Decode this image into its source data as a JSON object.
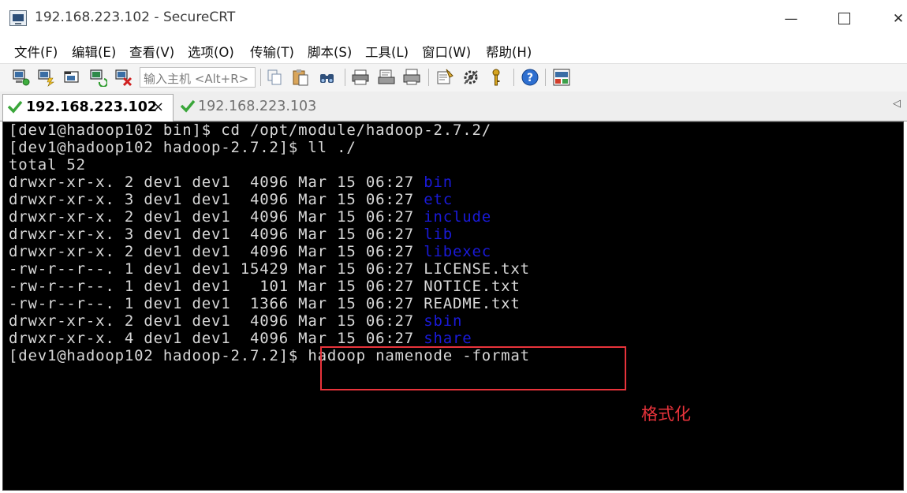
{
  "window": {
    "title": "192.168.223.102 - SecureCRT",
    "minimize_glyph": "—",
    "close_glyph": "✕"
  },
  "menu": [
    "文件(F)",
    "编辑(E)",
    "查看(V)",
    "选项(O)",
    "传输(T)",
    "脚本(S)",
    "工具(L)",
    "窗口(W)",
    "帮助(H)"
  ],
  "toolbar": {
    "host_placeholder": "输入主机 <Alt+R>",
    "icons": [
      "connect-icon",
      "quick-connect-icon",
      "connect-in-tab-icon",
      "reconnect-icon",
      "disconnect-icon",
      "copy-icon",
      "paste-icon",
      "find-icon",
      "print-icon",
      "print-selection-icon",
      "print-screen-icon",
      "session-options-icon",
      "global-options-icon",
      "key-icon",
      "help-icon",
      "sftp-icon"
    ]
  },
  "tabs": [
    {
      "label": "192.168.223.102",
      "active": true,
      "close_glyph": "×"
    },
    {
      "label": "192.168.223.103",
      "active": false
    }
  ],
  "tab_scroll_glyph": "◁",
  "terminal": {
    "lines": [
      {
        "text": "[dev1@hadoop102 bin]$ cd /opt/module/hadoop-2.7.2/",
        "dir": ""
      },
      {
        "text": "[dev1@hadoop102 hadoop-2.7.2]$ ll ./",
        "dir": ""
      },
      {
        "text": "total 52",
        "dir": ""
      },
      {
        "text": "drwxr-xr-x. 2 dev1 dev1  4096 Mar 15 06:27 ",
        "dir": "bin"
      },
      {
        "text": "drwxr-xr-x. 3 dev1 dev1  4096 Mar 15 06:27 ",
        "dir": "etc"
      },
      {
        "text": "drwxr-xr-x. 2 dev1 dev1  4096 Mar 15 06:27 ",
        "dir": "include"
      },
      {
        "text": "drwxr-xr-x. 3 dev1 dev1  4096 Mar 15 06:27 ",
        "dir": "lib"
      },
      {
        "text": "drwxr-xr-x. 2 dev1 dev1  4096 Mar 15 06:27 ",
        "dir": "libexec"
      },
      {
        "text": "-rw-r--r--. 1 dev1 dev1 15429 Mar 15 06:27 LICENSE.txt",
        "dir": ""
      },
      {
        "text": "-rw-r--r--. 1 dev1 dev1   101 Mar 15 06:27 NOTICE.txt",
        "dir": ""
      },
      {
        "text": "-rw-r--r--. 1 dev1 dev1  1366 Mar 15 06:27 README.txt",
        "dir": ""
      },
      {
        "text": "drwxr-xr-x. 2 dev1 dev1  4096 Mar 15 06:27 ",
        "dir": "sbin"
      },
      {
        "text": "drwxr-xr-x. 4 dev1 dev1  4096 Mar 15 06:27 ",
        "dir": "share"
      },
      {
        "text": "[dev1@hadoop102 hadoop-2.7.2]$ hadoop namenode -format",
        "dir": ""
      }
    ]
  },
  "annotation": {
    "label": "格式化",
    "color": "#e8333b"
  },
  "colors": {
    "terminal_bg": "#000000",
    "terminal_fg": "#d8d8d8",
    "directory": "#1a1ad8"
  }
}
